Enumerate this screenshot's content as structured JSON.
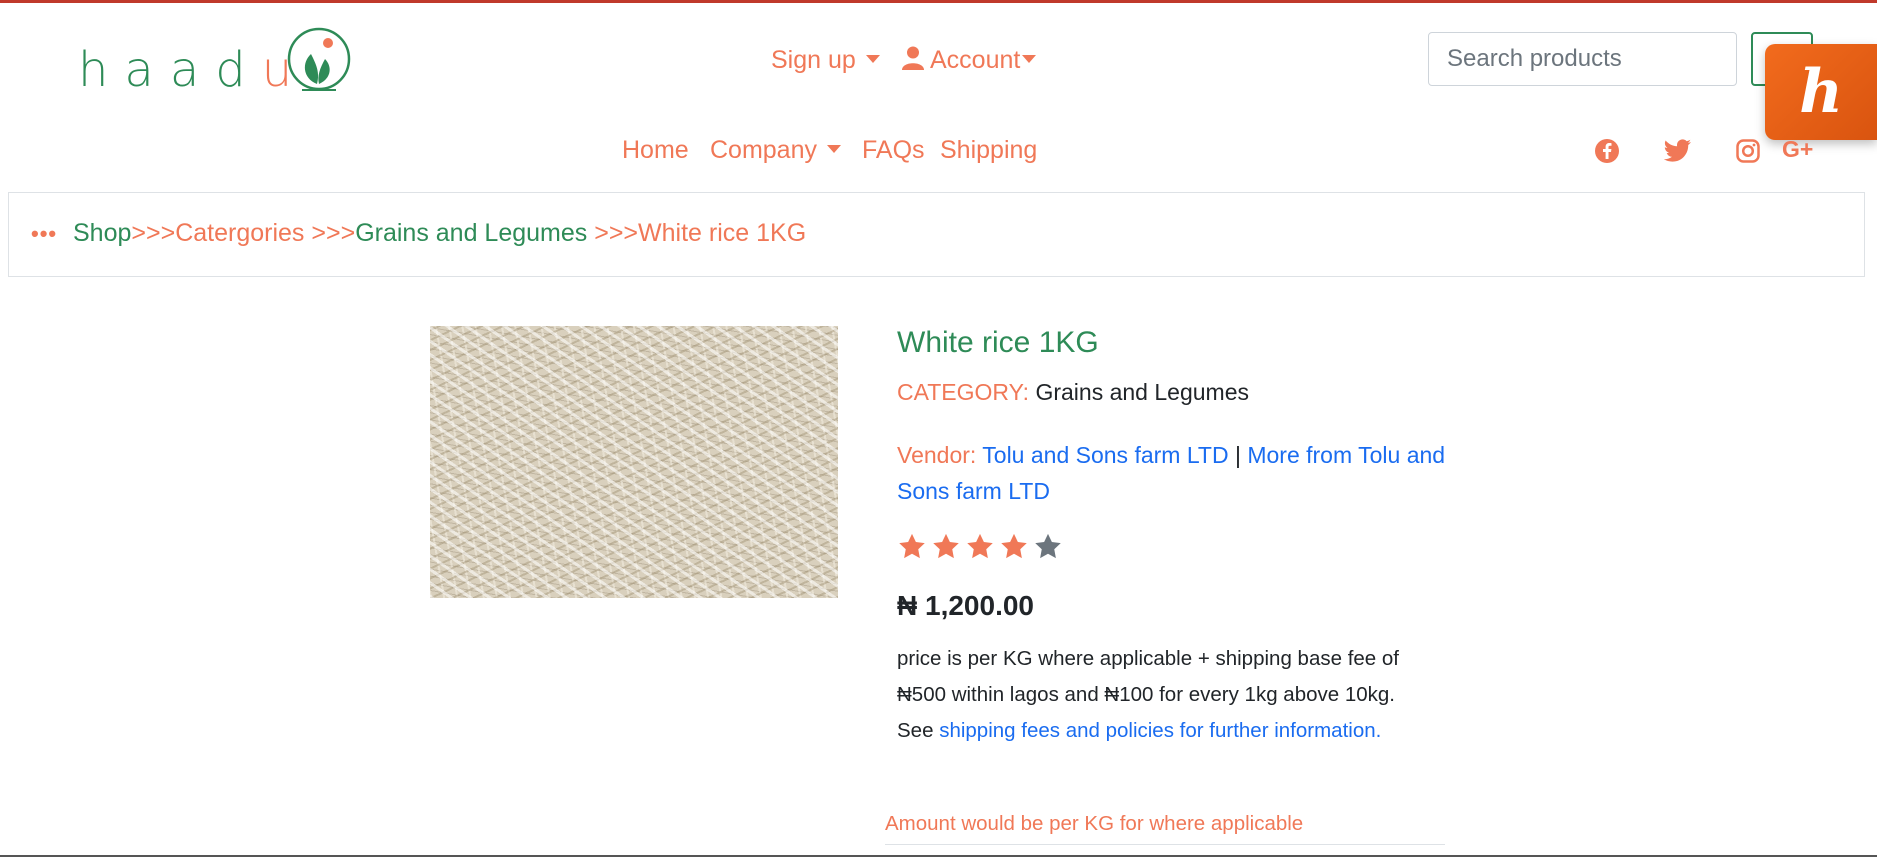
{
  "logo": {
    "text_main": "haad",
    "text_accent": "u"
  },
  "header": {
    "signup_label": "Sign up",
    "account_label": "Account",
    "search_placeholder": "Search products"
  },
  "nav": {
    "home": "Home",
    "company": "Company",
    "faqs": "FAQs",
    "shipping": "Shipping"
  },
  "social": [
    "facebook-icon",
    "twitter-icon",
    "instagram-icon",
    "google-plus-icon"
  ],
  "breadcrumb": {
    "shop": "Shop",
    "sep1": ">>>",
    "categories": "Catergories",
    "sep2": " >>>",
    "grains": "Grains and Legumes",
    "sep3": " >>>",
    "current": "White rice 1KG"
  },
  "product": {
    "title": "White rice 1KG",
    "category_label": "CATEGORY:",
    "category_value": "Grains and Legumes",
    "vendor_label": "Vendor:",
    "vendor_name": "Tolu and Sons farm LTD",
    "vendor_sep": "|",
    "vendor_more": "More from Tolu and Sons farm LTD",
    "rating": 4,
    "rating_max": 5,
    "price": "₦ 1,200.00",
    "info_text": "price is per KG where applicable + shipping base fee of ₦500 within lagos and ₦100 for every 1kg above 10kg. See",
    "info_link": "shipping fees and policies for further information.",
    "amount_note": "Amount would be per KG for where applicable"
  },
  "colors": {
    "brand_green": "#2e8b57",
    "brand_orange": "#f07857",
    "link_blue": "#1a6cf0",
    "star_inactive": "#6c757d"
  }
}
